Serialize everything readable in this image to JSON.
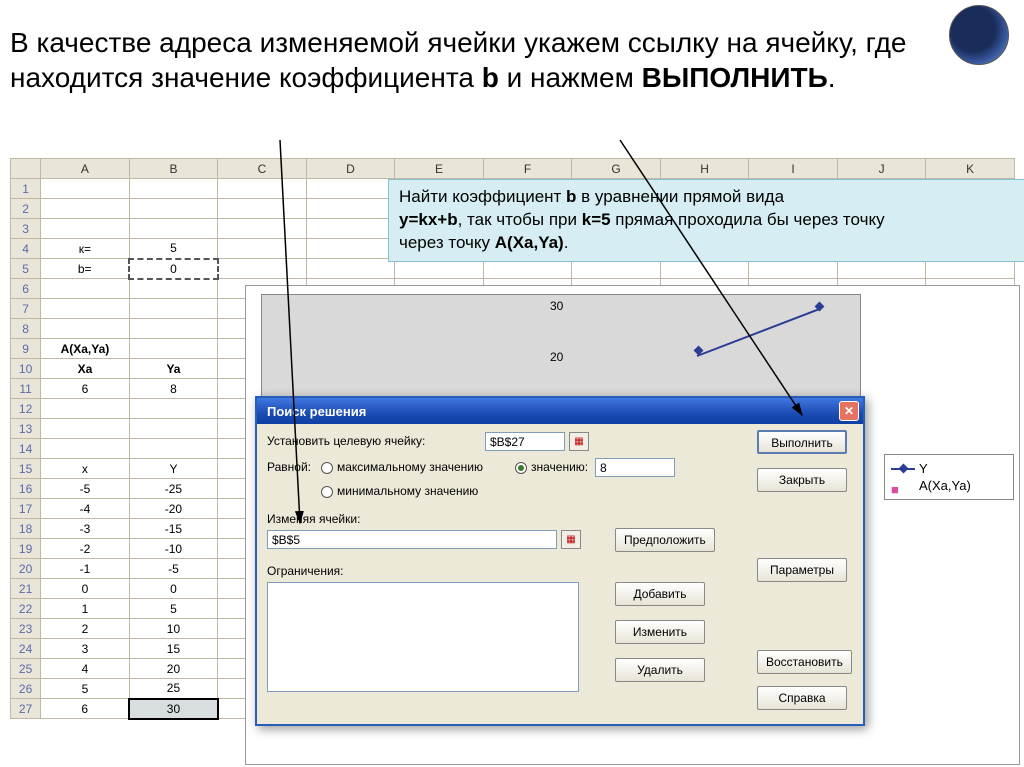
{
  "slide": {
    "text_before_b": "В качестве адреса изменяемой ячейки укажем ссылку на ячейку, где находится значение коэффициента ",
    "b": "b",
    "text_mid": "  и нажмем ",
    "action": "ВЫПОЛНИТЬ",
    "text_after": "."
  },
  "task": {
    "line1a": "Найти  коэффициент ",
    "line1b": "b",
    "line1c": " в уравнении прямой вида ",
    "line2a": "y=kx+b",
    "line2b": ", так чтобы при ",
    "line2c": "k=5",
    "line2d": " прямая проходила бы через точку ",
    "line2e": "A(Xa,Ya)",
    "line2f": "."
  },
  "columns": [
    "A",
    "B",
    "C",
    "D",
    "E",
    "F",
    "G",
    "H",
    "I",
    "J",
    "K"
  ],
  "rows": {
    "r4": {
      "a": "к=",
      "b": "5"
    },
    "r5": {
      "a": "b=",
      "b": "0"
    },
    "r9": {
      "a": "A(Xa,Ya)"
    },
    "r10": {
      "a": "Xa",
      "b": "Ya"
    },
    "r11": {
      "a": "6",
      "b": "8"
    },
    "r15": {
      "a": "x",
      "b": "Y"
    },
    "r16": {
      "a": "-5",
      "b": "-25"
    },
    "r17": {
      "a": "-4",
      "b": "-20"
    },
    "r18": {
      "a": "-3",
      "b": "-15"
    },
    "r19": {
      "a": "-2",
      "b": "-10"
    },
    "r20": {
      "a": "-1",
      "b": "-5"
    },
    "r21": {
      "a": "0",
      "b": "0"
    },
    "r22": {
      "a": "1",
      "b": "5"
    },
    "r23": {
      "a": "2",
      "b": "10"
    },
    "r24": {
      "a": "3",
      "b": "15"
    },
    "r25": {
      "a": "4",
      "b": "20"
    },
    "r26": {
      "a": "5",
      "b": "25"
    },
    "r27": {
      "a": "6",
      "b": "30"
    }
  },
  "chart": {
    "tick30": "30",
    "tick20": "20",
    "legend_y": "Y",
    "legend_a": "A(Xa,Ya)"
  },
  "dialog": {
    "title": "Поиск решения",
    "target_label": "Установить целевую ячейку:",
    "target_value": "$B$27",
    "equal_label": "Равной:",
    "opt_max": "максимальному значению",
    "opt_val": "значению:",
    "opt_min": "минимальному значению",
    "value": "8",
    "changing_label": "Изменяя ячейки:",
    "changing_value": "$B$5",
    "suggest": "Предположить",
    "constraints_label": "Ограничения:",
    "add": "Добавить",
    "edit": "Изменить",
    "delete": "Удалить",
    "run": "Выполнить",
    "close": "Закрыть",
    "params": "Параметры",
    "restore": "Восстановить",
    "help": "Справка"
  },
  "chart_data": {
    "type": "line",
    "series": [
      {
        "name": "Y",
        "x": [
          -5,
          -4,
          -3,
          -2,
          -1,
          0,
          1,
          2,
          3,
          4,
          5,
          6
        ],
        "y": [
          -25,
          -20,
          -15,
          -10,
          -5,
          0,
          5,
          10,
          15,
          20,
          25,
          30
        ]
      },
      {
        "name": "A(Xa,Ya)",
        "x": [
          6
        ],
        "y": [
          8
        ]
      }
    ],
    "y_ticks_visible": [
      20,
      30
    ],
    "title": "",
    "xlabel": "",
    "ylabel": ""
  }
}
